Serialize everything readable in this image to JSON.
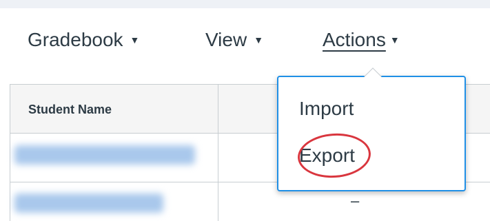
{
  "menu": {
    "items": [
      {
        "label": "Gradebook"
      },
      {
        "label": "View"
      },
      {
        "label": "Actions"
      }
    ],
    "active": "Actions"
  },
  "gradebook": {
    "header": {
      "student_name": "Student Name"
    },
    "rows": [
      {
        "student_name_obscured": true,
        "value": ""
      },
      {
        "student_name_obscured": true,
        "value": "–"
      }
    ]
  },
  "actions_menu": {
    "items": [
      {
        "label": "Import"
      },
      {
        "label": "Export",
        "highlighted": true
      }
    ]
  },
  "colors": {
    "accent": "#1f8fe6",
    "highlight": "#d9363e",
    "text": "#2d3b45",
    "border": "#c7cdd1"
  }
}
